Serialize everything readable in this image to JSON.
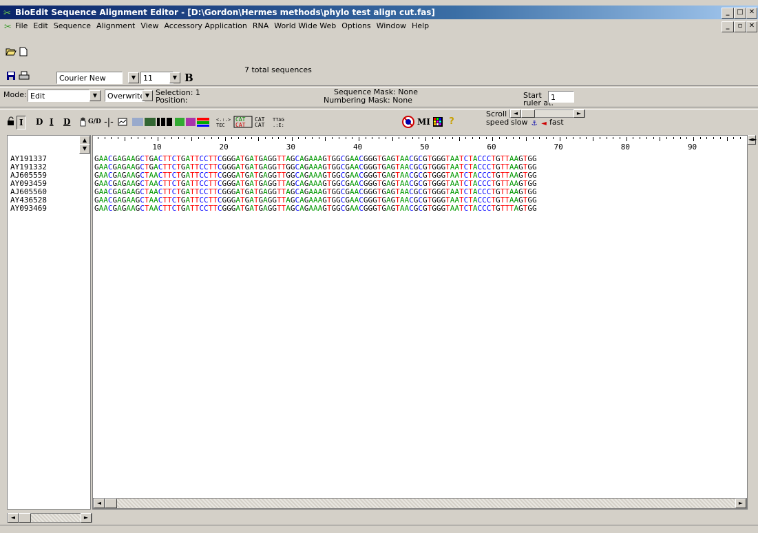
{
  "window": {
    "title": "BioEdit Sequence Alignment Editor - [D:\\Gordon\\Hermes methods\\phylo test align cut.fas]",
    "minimize_label": "_",
    "restore_label": "□",
    "close_label": "✕",
    "child_minimize_label": "_",
    "child_restore_label": "▫",
    "child_close_label": "✕"
  },
  "menu": [
    "File",
    "Edit",
    "Sequence",
    "Alignment",
    "View",
    "Accessory Application",
    "RNA",
    "World Wide Web",
    "Options",
    "Window",
    "Help"
  ],
  "toolbar": {
    "font_name": "Courier New",
    "font_size": "11",
    "bold_label": "B",
    "total_sequences": "7 total sequences"
  },
  "modebar": {
    "mode_label": "Mode:",
    "mode_value": "Edit",
    "overwrite_value": "Overwrite",
    "selection_label": "Selection: 1",
    "position_label": "Position:",
    "sequence_mask": "Sequence Mask: None",
    "numbering_mask": "Numbering Mask: None",
    "start_label": "Start",
    "ruler_at_label": "ruler at:",
    "ruler_start_value": "1"
  },
  "tools": {
    "i_label": "I",
    "d_label": "D",
    "i_underline_label": "I",
    "d_underline_label": "D",
    "gd_label": "G/D",
    "mi_label": "MI",
    "scroll_label": "Scroll",
    "speed_label": "speed",
    "slow_label": "slow",
    "fast_label": "fast"
  },
  "ruler": {
    "numbers": [
      "10",
      "20",
      "30",
      "40",
      "50",
      "60",
      "70",
      "80",
      "90"
    ]
  },
  "sequences": [
    {
      "name": "AY191337",
      "seq": "GAACGAGAAGCTGACTTCTGATTCCTTCGGGATGATGAGGTTAGCAGAAAGTGGCGAACGGGTGAGTAACGCGTGGGTAATCTACCCTGTTAAGTGG"
    },
    {
      "name": "AY191332",
      "seq": "GAACGAGAAGCTGACTTCTGATTCCTTCGGGATGATGAGGTTGGCAGAAAGTGGCGAACGGGTGAGTAACGCGTGGGTAATCTACCCTGTTAAGTGG"
    },
    {
      "name": "AJ605559",
      "seq": "GAACGAGAAGCTAACTTCTGATTCCTTCGGGATGATGAGGTTGGCAGAAAGTGGCGAACGGGTGAGTAACGCGTGGGTAATCTACCCTGTTAAGTGG"
    },
    {
      "name": "AY093459",
      "seq": "GAACGAGAAGCTAACTTCTGATTCCTTCGGGATGATGAGGTTAGCAGAAAGTGGCGAACGGGTGAGTAACGCGTGGGTAATCTACCCTGTTAAGTGG"
    },
    {
      "name": "AJ605560",
      "seq": "GAACGAGAAGCTAACTTCTGATTCCTTCGGGATGATGAGGTTAGCAGAAAGTGGCGAACGGGTGAGTAACGCGTGGGTAATCTACCCTGTTAAGTGG"
    },
    {
      "name": "AY436528",
      "seq": "GAACGAGAAGCTAACTTCTGATTCCTTCGGGATGATGAGGTTAGCAGAAAGTGGCGAACGGGTGAGTAACGCGTGGGTAATCTACCCTGTTAAGTGG"
    },
    {
      "name": "AY093469",
      "seq": "GAACGAGAAGCTAACTTCTGATTCCTTCGGGATGATGAGGTTAGCAGAAAGTGGCGAACGGGTGAGTAACGCGTGGGTAATCTACCCTGTTTAGTGG"
    }
  ],
  "colors": {
    "A": "#009900",
    "C": "#0000ff",
    "G": "#000000",
    "T": "#ff0000"
  }
}
